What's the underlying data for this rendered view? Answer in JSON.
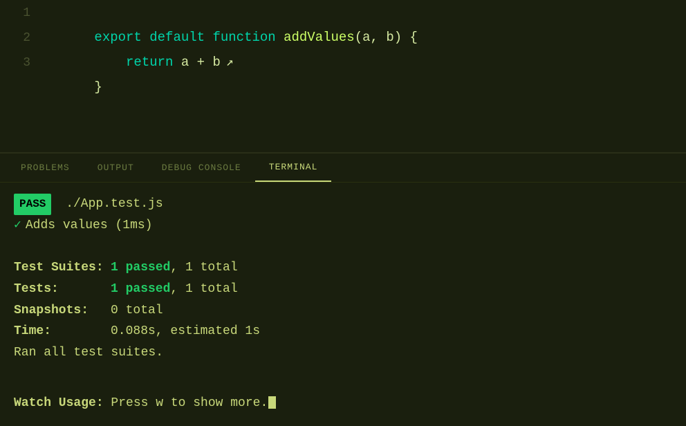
{
  "editor": {
    "lines": [
      {
        "number": "1",
        "tokens": [
          {
            "text": "export ",
            "class": "kw-export"
          },
          {
            "text": "default ",
            "class": "kw-default"
          },
          {
            "text": "function ",
            "class": "kw-function"
          },
          {
            "text": "addValues",
            "class": "fn-name"
          },
          {
            "text": "(a, b) {",
            "class": "param"
          }
        ]
      },
      {
        "number": "2",
        "tokens": [
          {
            "text": "    return ",
            "class": "kw-return"
          },
          {
            "text": "a + b",
            "class": "param"
          }
        ],
        "has_cursor": true
      },
      {
        "number": "3",
        "tokens": [
          {
            "text": "}",
            "class": "brace"
          }
        ]
      }
    ]
  },
  "tabs": {
    "items": [
      {
        "label": "PROBLEMS",
        "active": false
      },
      {
        "label": "OUTPUT",
        "active": false
      },
      {
        "label": "DEBUG CONSOLE",
        "active": false
      },
      {
        "label": "TERMINAL",
        "active": true
      }
    ]
  },
  "terminal": {
    "pass_badge": "PASS",
    "test_file": " ./App.test.js",
    "check_mark": "✓",
    "test_name": "Adds values (1ms)",
    "stats": [
      {
        "label": "Test Suites:",
        "green_part": "1 passed",
        "rest": ", 1 total"
      },
      {
        "label": "Tests:      ",
        "green_part": "1 passed",
        "rest": ", 1 total"
      },
      {
        "label": "Snapshots:  ",
        "green_part": "",
        "rest": "0 total"
      },
      {
        "label": "Time:       ",
        "green_part": "",
        "rest": "0.088s, estimated 1s"
      }
    ],
    "ran_all": "Ran all test suites.",
    "watch_label": "Watch Usage:",
    "watch_value": " Press w to show more."
  }
}
